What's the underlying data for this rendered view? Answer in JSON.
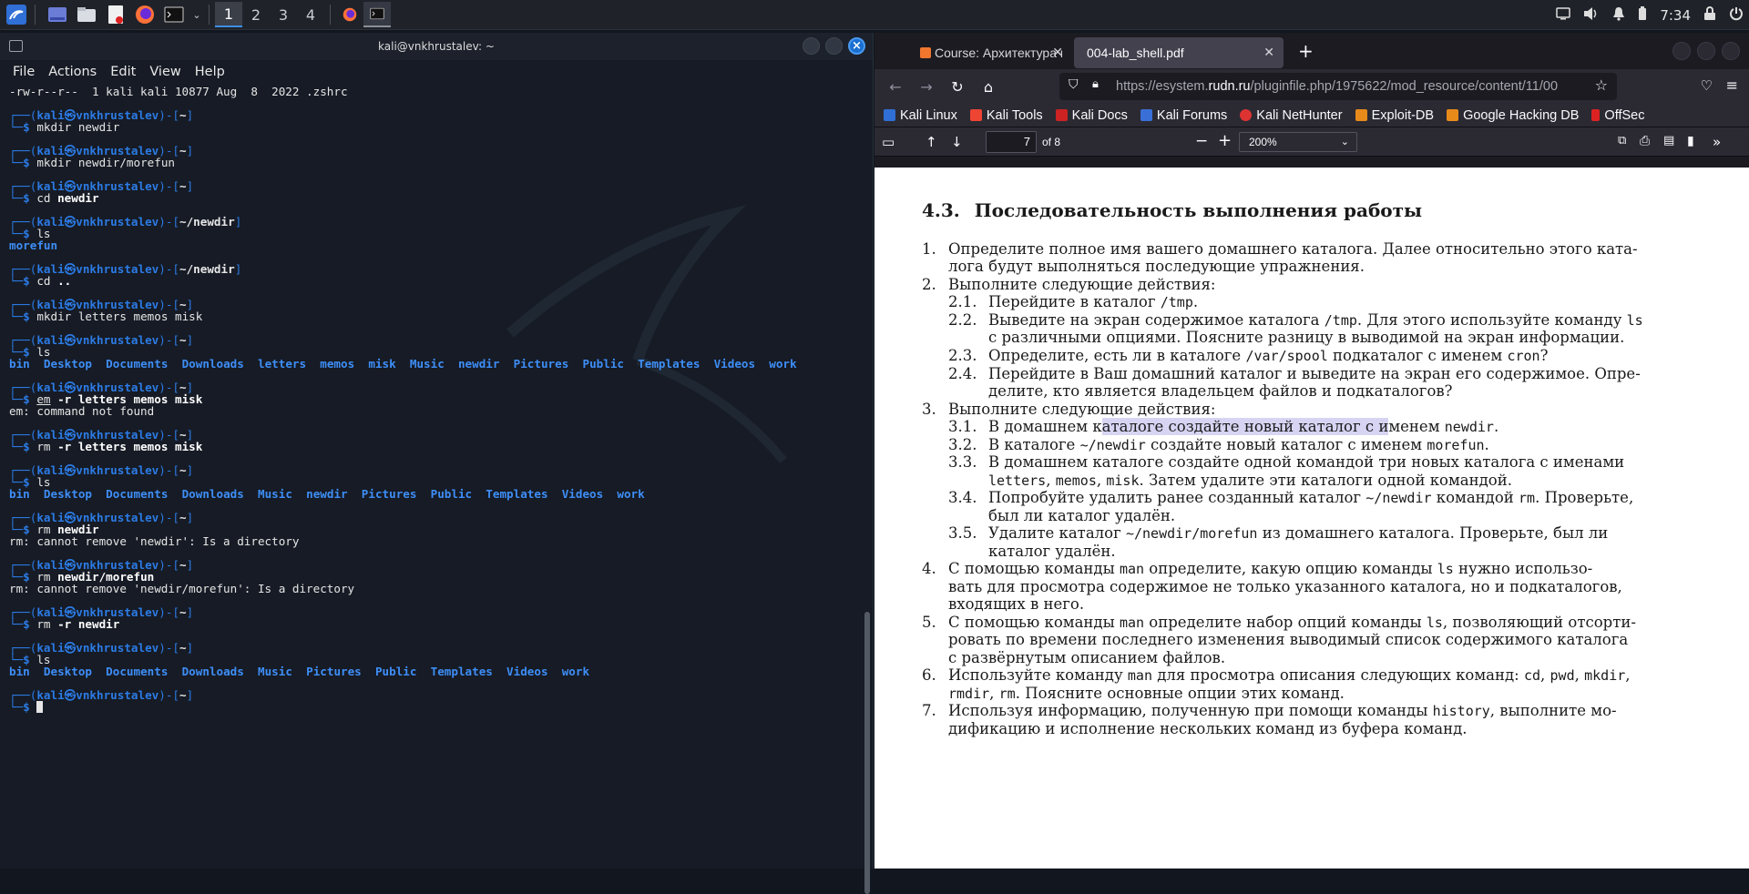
{
  "taskbar": {
    "workspaces": [
      "1",
      "2",
      "3",
      "4"
    ],
    "clock": "7:34"
  },
  "terminal": {
    "title": "kali@vnkhrustalev: ~",
    "menu": [
      "File",
      "Actions",
      "Edit",
      "View",
      "Help"
    ],
    "first_line": "-rw-r--r--  1 kali kali 10877 Aug  8  2022 .zshrc",
    "prompt_user": "kali",
    "prompt_host": "vnkhrustalev",
    "home": "~",
    "newdir_path": "~/newdir",
    "blocks": [
      {
        "dir": "~",
        "cmd": "mkdir",
        "args": " newdir",
        "bold": false,
        "out": []
      },
      {
        "dir": "~",
        "cmd": "mkdir",
        "args": " newdir/morefun",
        "bold": false,
        "out": []
      },
      {
        "dir": "~",
        "cmd": "cd",
        "args": " newdir",
        "bold": true,
        "out": []
      },
      {
        "dir": "~/newdir",
        "cmd": "ls",
        "args": "",
        "bold": false,
        "out": [
          "morefun"
        ],
        "outdir": true
      },
      {
        "dir": "~/newdir",
        "cmd": "cd",
        "args": " ..",
        "bold": true,
        "out": []
      },
      {
        "dir": "~",
        "cmd": "mkdir",
        "args": " letters memos misk",
        "bold": false,
        "out": []
      },
      {
        "dir": "~",
        "cmd": "ls",
        "args": "",
        "bold": false,
        "lsout": [
          "bin",
          "Desktop",
          "Documents",
          "Downloads",
          "letters",
          "memos",
          "misk",
          "Music",
          "newdir",
          "Pictures",
          "Public",
          "Templates",
          "Videos",
          "work"
        ]
      },
      {
        "dir": "~",
        "cmd": "em",
        "args": " -r letters memos misk",
        "bold": true,
        "out": [
          "em: command not found"
        ],
        "underline": true
      },
      {
        "dir": "~",
        "cmd": "rm",
        "args": " -r letters memos misk",
        "bold": true,
        "out": []
      },
      {
        "dir": "~",
        "cmd": "ls",
        "args": "",
        "bold": false,
        "lsout": [
          "bin",
          "Desktop",
          "Documents",
          "Downloads",
          "Music",
          "newdir",
          "Pictures",
          "Public",
          "Templates",
          "Videos",
          "work"
        ]
      },
      {
        "dir": "~",
        "cmd": "rm",
        "args": " newdir",
        "bold": true,
        "out": [
          "rm: cannot remove 'newdir': Is a directory"
        ]
      },
      {
        "dir": "~",
        "cmd": "rm",
        "args": " newdir/morefun",
        "bold": true,
        "out": [
          "rm: cannot remove 'newdir/morefun': Is a directory"
        ]
      },
      {
        "dir": "~",
        "cmd": "rm",
        "args": " -r newdir",
        "bold": true,
        "out": []
      },
      {
        "dir": "~",
        "cmd": "ls",
        "args": "",
        "bold": false,
        "lsout": [
          "bin",
          "Desktop",
          "Documents",
          "Downloads",
          "Music",
          "Pictures",
          "Public",
          "Templates",
          "Videos",
          "work"
        ]
      },
      {
        "dir": "~",
        "cmd": "",
        "args": "",
        "bold": false,
        "out": [],
        "cursor": true
      }
    ]
  },
  "browser": {
    "tabs": [
      {
        "label": "Course: Архитектура ком"
      },
      {
        "label": "004-lab_shell.pdf"
      }
    ],
    "url_prefix": "https://esystem.",
    "url_domain": "rudn.ru",
    "url_rest": "/pluginfile.php/1975622/mod_resource/content/11/00",
    "bookmarks": [
      "Kali Linux",
      "Kali Tools",
      "Kali Docs",
      "Kali Forums",
      "Kali NetHunter",
      "Exploit-DB",
      "Google Hacking DB",
      "OffSec"
    ],
    "page_number": "7",
    "page_of": "of 8",
    "zoom": "200%"
  },
  "pdf": {
    "section_num": "4.3.",
    "section_title": "Последовательность выполнения работы",
    "lines": {
      "l1a": "Определите полное имя вашего домашнего каталога. Далее относительно этого ката-",
      "l1b": "лога будут выполняться последующие упражнения.",
      "l2": "Выполните следующие действия:",
      "l21a": "Перейдите в каталог ",
      "l21m": "/tmp",
      "l21b": ".",
      "l22a": "Выведите на экран содержимое каталога ",
      "l22m": "/tmp",
      "l22b": ". Для этого используйте команду ",
      "l22m2": "ls",
      "l22c": "с различными опциями. Поясните разницу в выводимой на экран информации.",
      "l23a": "Определите, есть ли в каталоге ",
      "l23m": "/var/spool",
      "l23b": " подкаталог с именем ",
      "l23m2": "cron",
      "l23c": "?",
      "l24a": "Перейдите в Ваш домашний каталог и выведите на экран его содержимое. Опре-",
      "l24b": "делите, кто является владельцем файлов и подкаталогов?",
      "l3": "Выполните следующие действия:",
      "l31a": "В домашнем к",
      "l31h": "аталоге создайте новый каталог с и",
      "l31b": "менем ",
      "l31m": "newdir",
      "l31c": ".",
      "l32a": "В каталоге ",
      "l32m": "~/newdir",
      "l32b": " создайте новый каталог с именем ",
      "l32m2": "morefun",
      "l32c": ".",
      "l33a": "В домашнем каталоге создайте одной командой три новых каталога с именами",
      "l33m1": "letters",
      "l33s1": ", ",
      "l33m2": "memos",
      "l33s2": ", ",
      "l33m3": "misk",
      "l33b": ". Затем удалите эти каталоги одной командой.",
      "l34a": "Попробуйте удалить ранее созданный каталог ",
      "l34m": "~/newdir",
      "l34b": " командой ",
      "l34m2": "rm",
      "l34c": ". Проверьте,",
      "l34d": "был ли каталог удалён.",
      "l35a": "Удалите каталог ",
      "l35m": "~/newdir/morefun",
      "l35b": " из домашнего каталога. Проверьте, был ли",
      "l35c": "каталог удалён.",
      "l4a": "С помощью команды ",
      "l4m": "man",
      "l4b": " определите, какую опцию команды ",
      "l4m2": "ls",
      "l4c": " нужно использо-",
      "l4d": "вать для просмотра содержимое не только указанного каталога, но и подкаталогов,",
      "l4e": "входящих в него.",
      "l5a": "С помощью команды ",
      "l5m": "man",
      "l5b": " определите набор опций команды ",
      "l5m2": "ls",
      "l5c": ", позволяющий отсорти-",
      "l5d": "ровать по времени последнего изменения выводимый список содержимого каталога",
      "l5e": "с развёрнутым описанием файлов.",
      "l6a": "Используйте команду ",
      "l6m": "man",
      "l6b": " для просмотра описания следующих команд: ",
      "l6m1": "cd",
      "l6s1": ", ",
      "l6m2": "pwd",
      "l6s2": ", ",
      "l6m3": "mkdir",
      "l6s3": ",",
      "l6m4": "rmdir",
      "l6s4": ", ",
      "l6m5": "rm",
      "l6c": ". Поясните основные опции этих команд.",
      "l7a": "Используя информацию, полученную при помощи команды ",
      "l7m": "history",
      "l7b": ", выполните мо-",
      "l7c": "дификацию и исполнение нескольких команд из буфера команд."
    },
    "nums": [
      "1.",
      "2.",
      "2.1.",
      "2.2.",
      "2.3.",
      "2.4.",
      "3.",
      "3.1.",
      "3.2.",
      "3.3.",
      "3.4.",
      "3.5.",
      "4.",
      "5.",
      "6.",
      "7."
    ]
  },
  "colors": {
    "terminal_bg": "#161b25",
    "prompt_blue": "#2c7be5",
    "dir_blue": "#3e8ef7",
    "browser_bg": "#2b2a33",
    "highlight": "#d7d4f3"
  }
}
